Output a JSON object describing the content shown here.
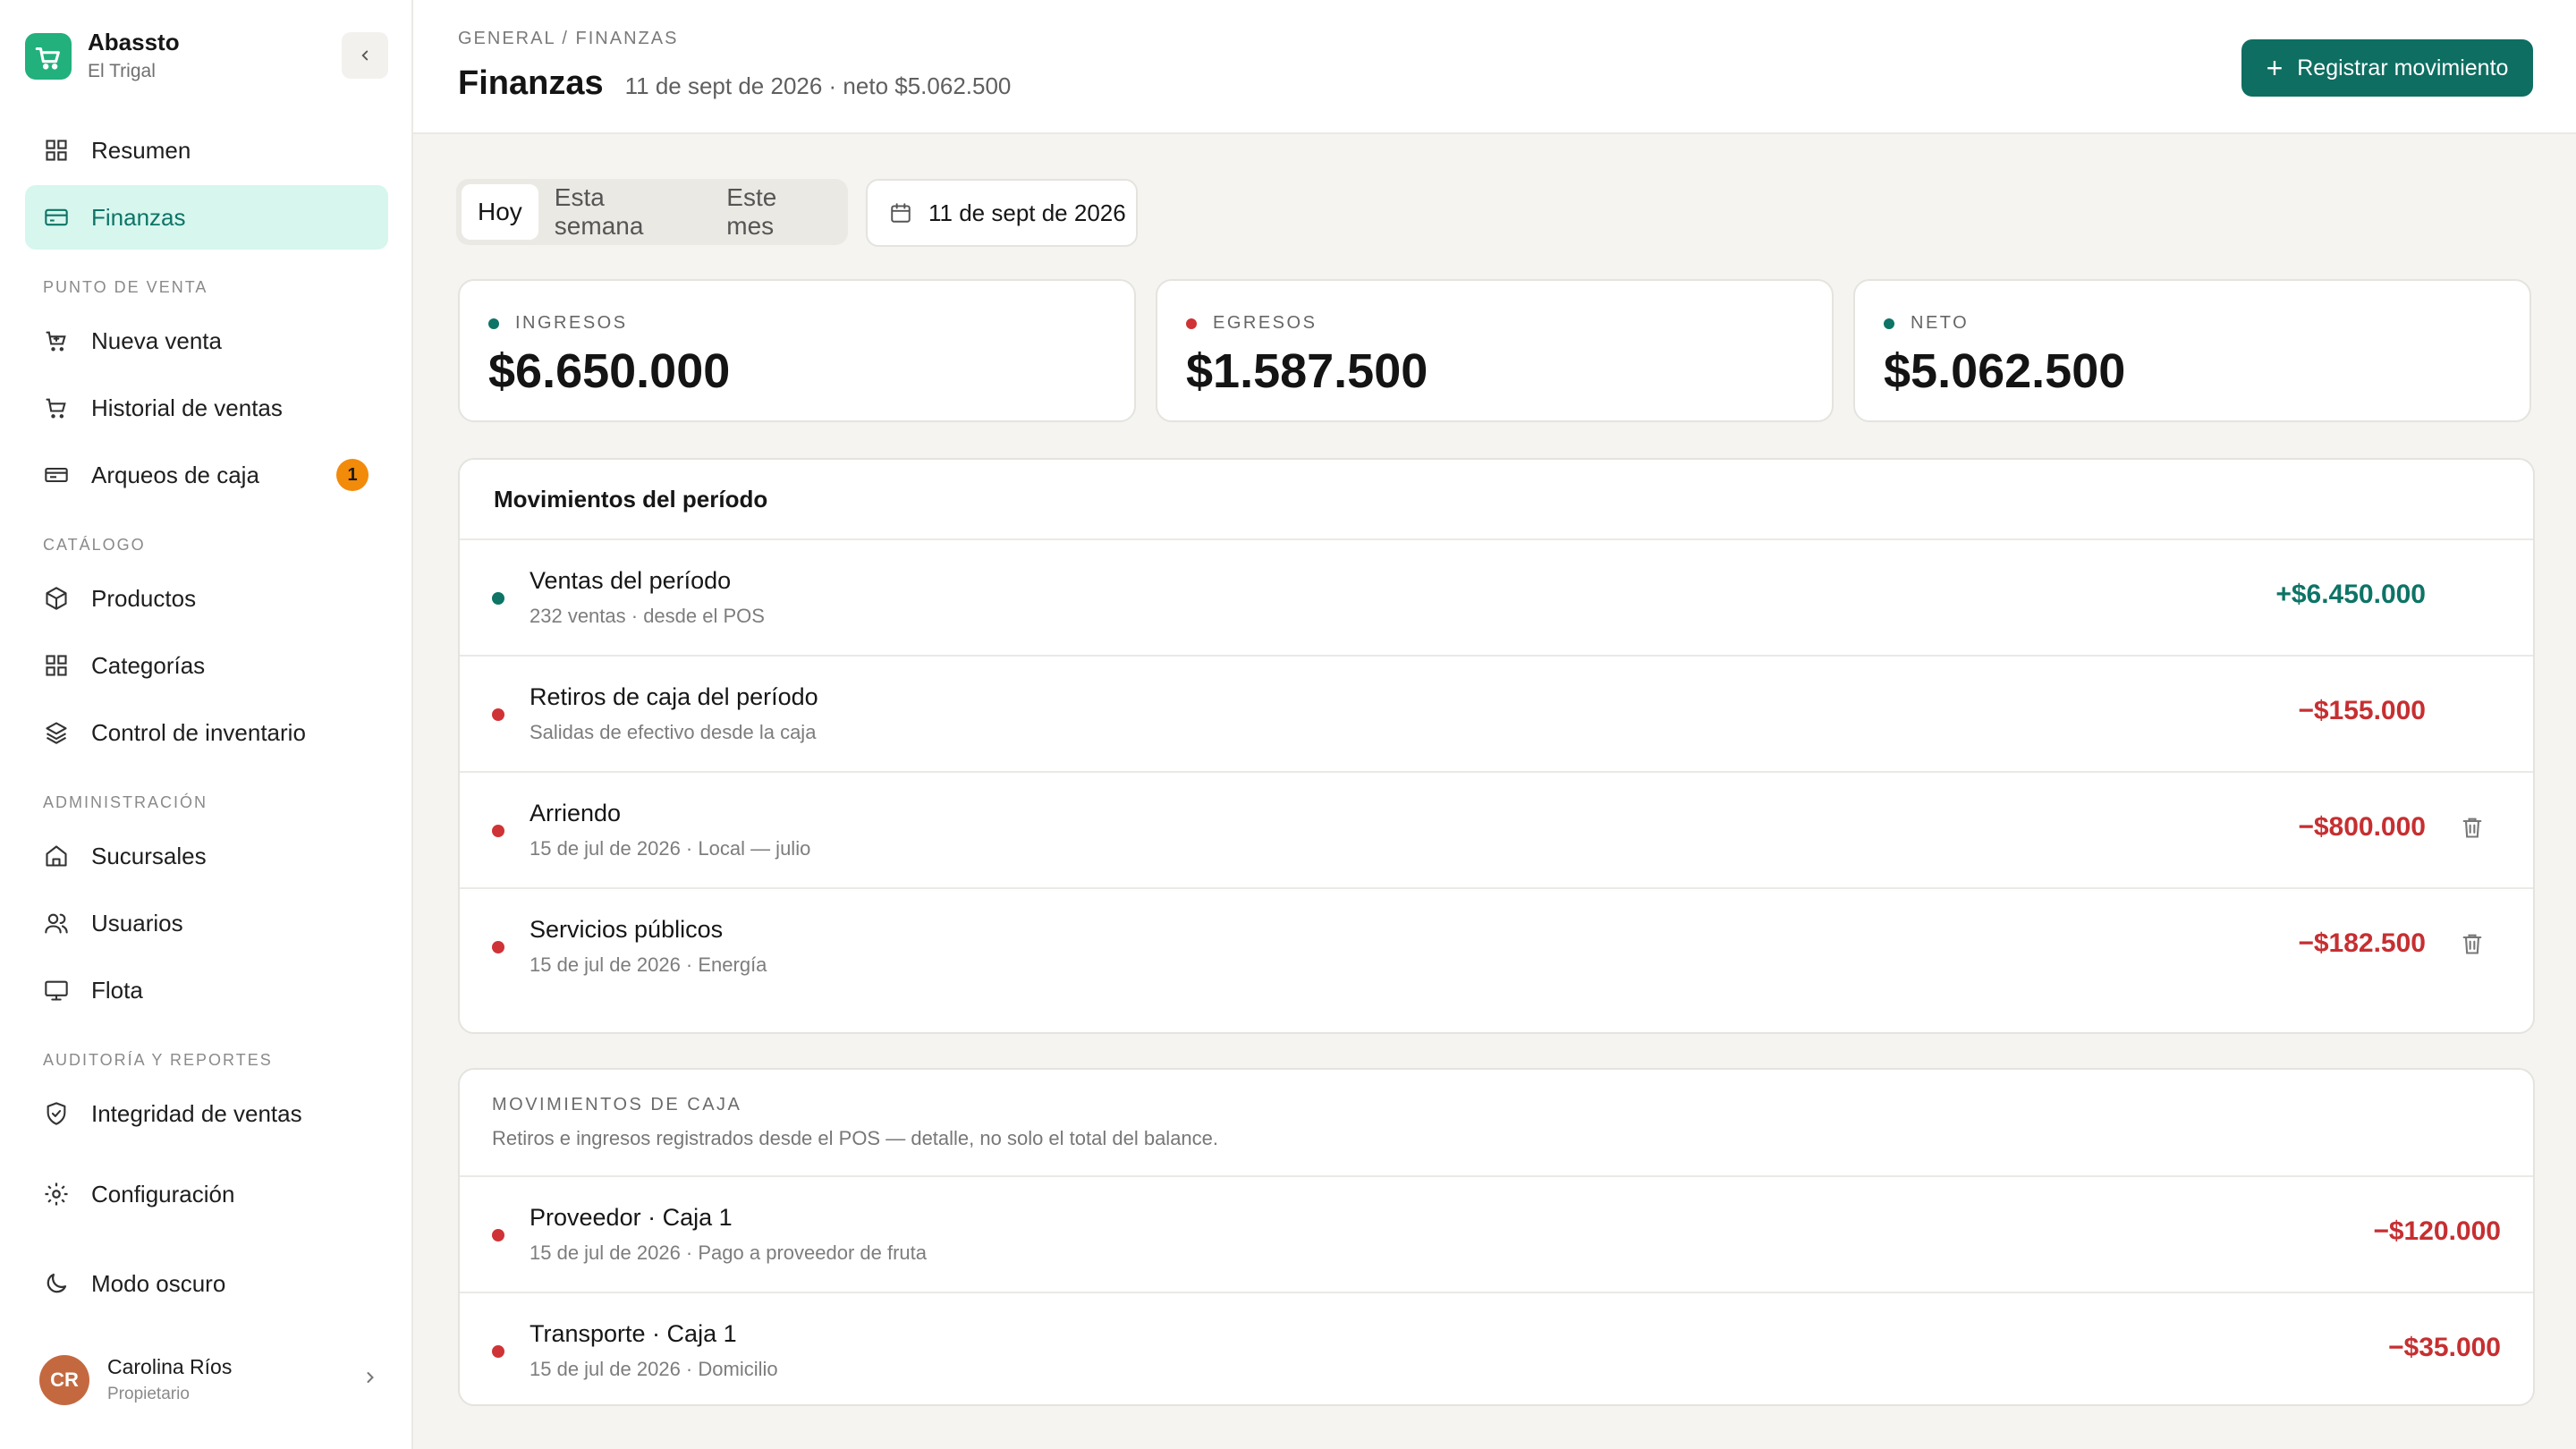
{
  "brand": {
    "name": "Abassto",
    "location": "El Trigal"
  },
  "sidebar": {
    "primary": [
      {
        "label": "Resumen",
        "icon": "grid-icon"
      },
      {
        "label": "Finanzas",
        "icon": "card-icon",
        "active": true
      }
    ],
    "sections": [
      {
        "label": "PUNTO DE VENTA",
        "items": [
          {
            "label": "Nueva venta",
            "icon": "cart-icon"
          },
          {
            "label": "Historial de ventas",
            "icon": "cart-outline-icon"
          },
          {
            "label": "Arqueos de caja",
            "icon": "cash-register-icon",
            "badge": "1"
          }
        ]
      },
      {
        "label": "CATÁLOGO",
        "items": [
          {
            "label": "Productos",
            "icon": "box-icon"
          },
          {
            "label": "Categorías",
            "icon": "grid-icon"
          },
          {
            "label": "Control de inventario",
            "icon": "layers-icon"
          }
        ]
      },
      {
        "label": "ADMINISTRACIÓN",
        "items": [
          {
            "label": "Sucursales",
            "icon": "store-icon"
          },
          {
            "label": "Usuarios",
            "icon": "users-icon"
          },
          {
            "label": "Flota",
            "icon": "monitor-icon"
          }
        ]
      },
      {
        "label": "AUDITORÍA Y REPORTES",
        "items": [
          {
            "label": "Integridad de ventas",
            "icon": "shield-check-icon"
          }
        ]
      }
    ],
    "settings_label": "Configuración",
    "dark_mode_label": "Modo oscuro",
    "user": {
      "initials": "CR",
      "name": "Carolina Ríos",
      "role": "Propietario"
    }
  },
  "header": {
    "breadcrumb": "GENERAL / FINANZAS",
    "title": "Finanzas",
    "subtitle": "11 de sept de 2026 · neto $5.062.500",
    "primary_button": "Registrar movimiento"
  },
  "filters": {
    "periods": [
      "Hoy",
      "Esta semana",
      "Este mes"
    ],
    "active_period": "Hoy",
    "date": "11 de sept de 2026"
  },
  "kpis": [
    {
      "label": "INGRESOS",
      "value": "$6.650.000",
      "color": "#0d7466"
    },
    {
      "label": "EGRESOS",
      "value": "$1.587.500",
      "color": "#d03335"
    },
    {
      "label": "NETO",
      "value": "$5.062.500",
      "color": "#0d7466"
    }
  ],
  "movements": {
    "title": "Movimientos del período",
    "rows": [
      {
        "title": "Ventas del período",
        "sub": "232 ventas · desde el POS",
        "amount": "+$6.450.000",
        "type": "pos",
        "deletable": false
      },
      {
        "title": "Retiros de caja del período",
        "sub": "Salidas de efectivo desde la caja",
        "amount": "−$155.000",
        "type": "neg",
        "deletable": false
      },
      {
        "title": "Arriendo",
        "sub": "15 de jul de 2026 · Local — julio",
        "amount": "−$800.000",
        "type": "neg",
        "deletable": true
      },
      {
        "title": "Servicios públicos",
        "sub": "15 de jul de 2026 · Energía",
        "amount": "−$182.500",
        "type": "neg",
        "deletable": true
      }
    ]
  },
  "cash": {
    "title": "MOVIMIENTOS DE CAJA",
    "description": "Retiros e ingresos registrados desde el POS — detalle, no solo el total del balance.",
    "rows": [
      {
        "title": "Proveedor · Caja 1",
        "sub": "15 de jul de 2026 · Pago a proveedor de fruta",
        "amount": "−$120.000"
      },
      {
        "title": "Transporte · Caja 1",
        "sub": "15 de jul de 2026 · Domicilio",
        "amount": "−$35.000"
      }
    ]
  },
  "colors": {
    "accent": "#0e6e61",
    "active_bg": "#d6f6ee",
    "badge": "#f28a0a",
    "negative": "#c62f31"
  }
}
